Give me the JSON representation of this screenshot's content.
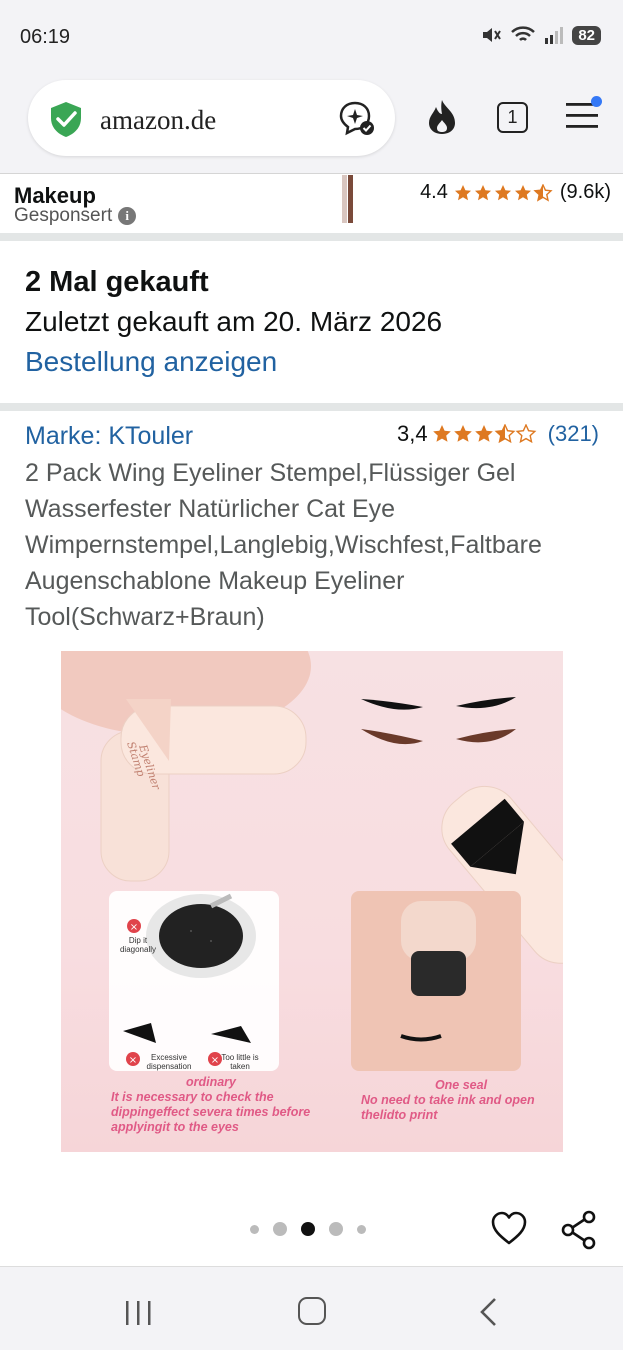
{
  "status_bar": {
    "time": "06:19",
    "battery": "82"
  },
  "browser": {
    "url": "amazon.de",
    "tab_count": "1"
  },
  "sponsored": {
    "title": "Makeup",
    "label": "Gesponsert",
    "rating": "4.4",
    "rating_count": "(9.6k)"
  },
  "purchase": {
    "title": "2 Mal gekauft",
    "last_bought": "Zuletzt gekauft am 20. März 2026",
    "view_order": "Bestellung anzeigen"
  },
  "product": {
    "brand": "Marke: KTouler",
    "rating": "3,4",
    "stars_value": 3.4,
    "review_count": "(321)",
    "title": "2 Pack Wing Eyeliner Stempel,Flüssiger Gel Wasserfester Natürlicher Cat Eye Wimpernstempel,Langlebig,Wischfest,Faltbare Augenschablone Makeup Eyeliner Tool(Schwarz+Braun)"
  },
  "image": {
    "stamp_text": "Eyeliner Stamp",
    "label_dip": "Dip it diagonally",
    "label_excessive": "Excessive dispensation",
    "label_too_little": "Too little is taken",
    "caption_left_head": "ordinary",
    "caption_left_body": "It is necessary to check the dippingeffect severa times before applyingit to the eyes",
    "caption_right_head": "One seal",
    "caption_right_body": "No need to take ink and open thelidto print"
  },
  "carousel": {
    "total": 5,
    "active_index": 2
  },
  "colors": {
    "link": "#2162a1",
    "star": "#de7921",
    "caption": "#e05a86"
  }
}
